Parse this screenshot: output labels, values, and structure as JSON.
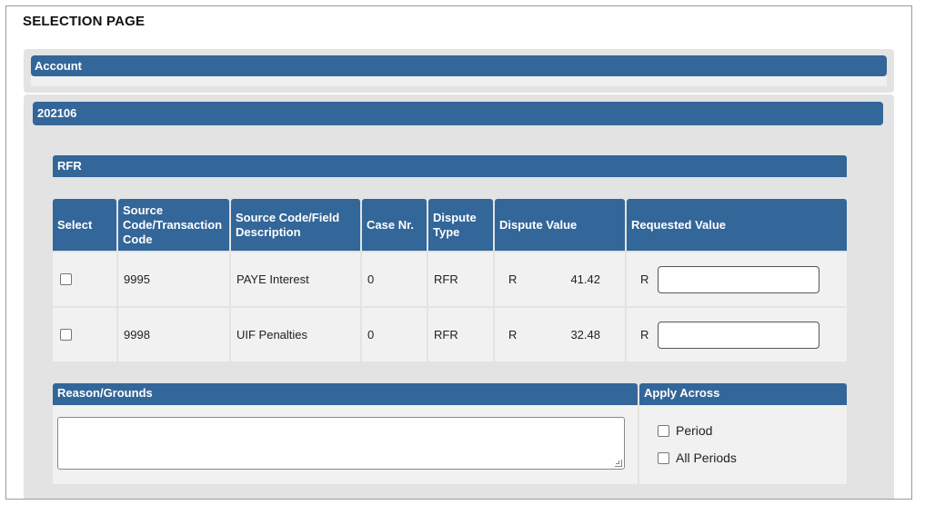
{
  "page": {
    "title": "SELECTION PAGE"
  },
  "account": {
    "header": "Account"
  },
  "period": {
    "header": "202106"
  },
  "rfr": {
    "header": "RFR"
  },
  "table": {
    "columns": {
      "select": "Select",
      "source_code": "Source Code/Transaction Code",
      "description": "Source Code/Field Description",
      "case_nr": "Case Nr.",
      "dispute_type": "Dispute Type",
      "dispute_value": "Dispute Value",
      "requested_value": "Requested Value"
    },
    "rows": [
      {
        "checked": false,
        "source_code": "9995",
        "description": "PAYE Interest",
        "case_nr": "0",
        "dispute_type": "RFR",
        "currency": "R",
        "dispute_value": "41.42",
        "requested_currency": "R",
        "requested_value": ""
      },
      {
        "checked": false,
        "source_code": "9998",
        "description": "UIF Penalties",
        "case_nr": "0",
        "dispute_type": "RFR",
        "currency": "R",
        "dispute_value": "32.48",
        "requested_currency": "R",
        "requested_value": ""
      }
    ]
  },
  "reason": {
    "header": "Reason/Grounds",
    "value": ""
  },
  "apply_across": {
    "header": "Apply Across",
    "options": [
      {
        "label": "Period",
        "checked": false
      },
      {
        "label": "All Periods",
        "checked": false
      }
    ]
  },
  "colors": {
    "header_blue": "#336699",
    "cell_bg": "#f1f1f1",
    "panel_bg": "#e3e3e3"
  }
}
